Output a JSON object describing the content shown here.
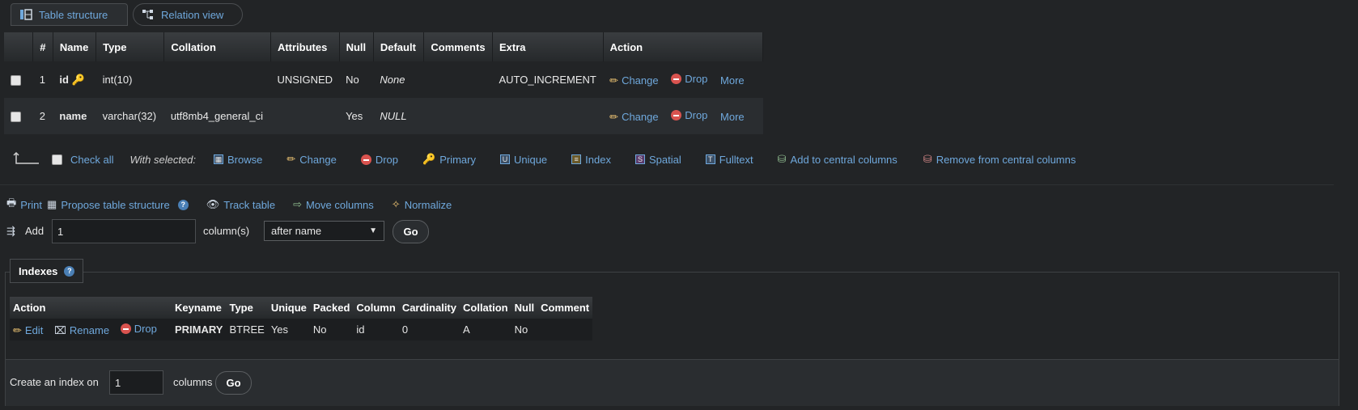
{
  "tabs": {
    "table_structure": "Table structure",
    "relation_view": "Relation view"
  },
  "structure": {
    "headers": [
      "#",
      "Name",
      "Type",
      "Collation",
      "Attributes",
      "Null",
      "Default",
      "Comments",
      "Extra",
      "Action"
    ],
    "rows": [
      {
        "num": "1",
        "name": "id",
        "type": "int(10)",
        "collation": "",
        "attributes": "UNSIGNED",
        "null": "No",
        "default": "None",
        "comments": "",
        "extra": "AUTO_INCREMENT"
      },
      {
        "num": "2",
        "name": "name",
        "type": "varchar(32)",
        "collation": "utf8mb4_general_ci",
        "attributes": "",
        "null": "Yes",
        "default": "NULL",
        "comments": "",
        "extra": ""
      }
    ],
    "actions": {
      "change": "Change",
      "drop": "Drop",
      "more": "More"
    }
  },
  "bulk": {
    "check_all": "Check all",
    "with_selected": "With selected:",
    "items": [
      "Browse",
      "Change",
      "Drop",
      "Primary",
      "Unique",
      "Index",
      "Spatial",
      "Fulltext",
      "Add to central columns",
      "Remove from central columns"
    ]
  },
  "tools": {
    "print": "Print",
    "propose": "Propose table structure",
    "track": "Track table",
    "move": "Move columns",
    "normalize": "Normalize"
  },
  "add_columns": {
    "label": "Add",
    "value": "1",
    "unit": "column(s)",
    "position": "after name",
    "go": "Go"
  },
  "indexes": {
    "legend": "Indexes",
    "headers": [
      "Action",
      "Keyname",
      "Type",
      "Unique",
      "Packed",
      "Column",
      "Cardinality",
      "Collation",
      "Null",
      "Comment"
    ],
    "row": {
      "edit": "Edit",
      "rename": "Rename",
      "drop": "Drop",
      "keyname": "PRIMARY",
      "type": "BTREE",
      "unique": "Yes",
      "packed": "No",
      "column": "id",
      "cardinality": "0",
      "collation": "A",
      "null": "No",
      "comment": ""
    },
    "create": {
      "label": "Create an index on",
      "value": "1",
      "unit": "columns",
      "go": "Go"
    }
  }
}
